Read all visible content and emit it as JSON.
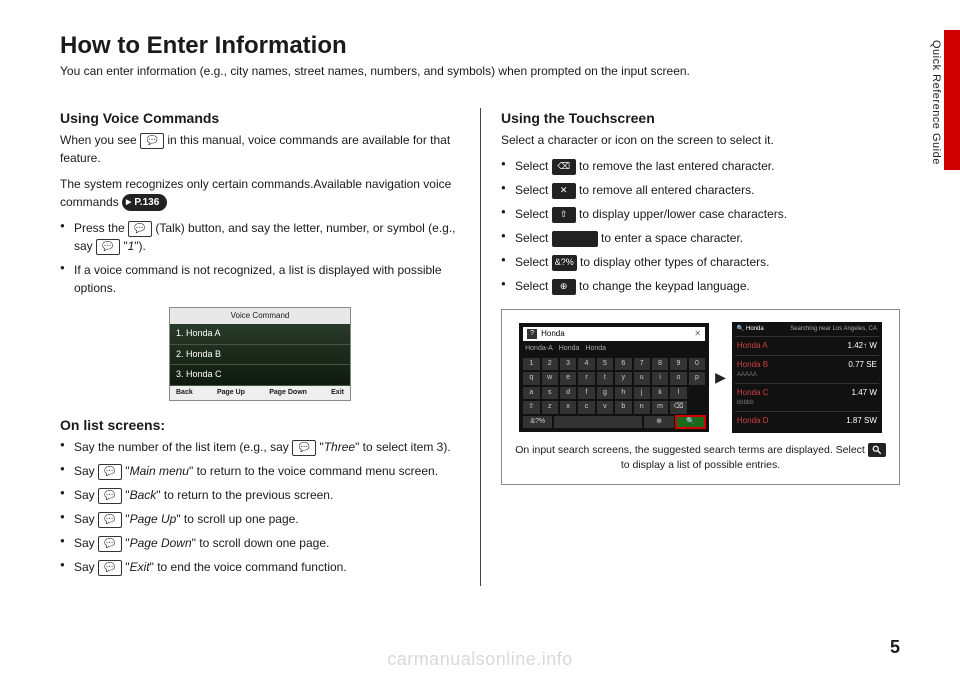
{
  "sideTab": "Quick Reference Guide",
  "title": "How to Enter Information",
  "intro": "You can enter information (e.g., city names, street names, numbers, and symbols) when prompted on the input screen.",
  "pageNum": "5",
  "watermark": "carmanualsonline.info",
  "voice": {
    "heading": "Using Voice Commands",
    "p1a": "When you see ",
    "p1b": " in this manual, voice commands are available for that feature.",
    "p2": "The system recognizes only certain commands.Available navigation voice commands ",
    "pageRef": "P.136",
    "b1a": "Press the ",
    "b1b": " (Talk) button, and say the letter, number, or symbol (e.g., say ",
    "b1c": " \"",
    "b1cmd": "1",
    "b1d": "\").",
    "b2": "If a voice command is not recognized, a list is displayed with possible options.",
    "shot": {
      "title": "Voice Command",
      "items": [
        "1. Honda A",
        "2. Honda B",
        "3. Honda C"
      ],
      "foot": [
        "Back",
        "Page Up",
        "Page Down",
        "Exit"
      ]
    }
  },
  "list": {
    "heading": "On list screens:",
    "b1a": "Say the number of the list item (e.g., say ",
    "b1b": " \"",
    "b1cmd": "Three",
    "b1c": "\" to select item 3).",
    "b2a": "Say ",
    "b2cmd": "Main menu",
    "b2b": "\" to return to the voice command menu screen.",
    "b3a": "Say ",
    "b3cmd": "Back",
    "b3b": "\" to return to the previous screen.",
    "b4a": "Say ",
    "b4cmd": "Page Up",
    "b4b": "\" to scroll up one page.",
    "b5a": "Say ",
    "b5cmd": "Page Down",
    "b5b": "\" to scroll down one page.",
    "b6a": "Say ",
    "b6cmd": "Exit",
    "b6b": "\" to end the voice command function."
  },
  "touch": {
    "heading": "Using the Touchscreen",
    "intro": "Select a character or icon on the screen to select it.",
    "b1": " to remove the last entered character.",
    "b2": " to remove all entered characters.",
    "b3": " to display upper/lower case characters.",
    "b4": " to enter a space character.",
    "b5": " to display other types of characters.",
    "b6": " to change the keypad language.",
    "select": "Select ",
    "icons": {
      "del": "⌫",
      "clear": "✕",
      "shift": "⇧",
      "sym": "&?%",
      "globe": "⊕"
    },
    "kb": {
      "input": "Honda",
      "sugg": [
        "Honda-A",
        "Honda",
        "Honda"
      ],
      "rows": [
        [
          "1",
          "2",
          "3",
          "4",
          "5",
          "6",
          "7",
          "8",
          "9",
          "0"
        ],
        [
          "q",
          "w",
          "e",
          "r",
          "t",
          "y",
          "u",
          "i",
          "o",
          "p"
        ],
        [
          "a",
          "s",
          "d",
          "f",
          "g",
          "h",
          "j",
          "k",
          "l",
          ""
        ],
        [
          "⇧",
          "z",
          "x",
          "c",
          "v",
          "b",
          "n",
          "m",
          "⌫",
          ""
        ]
      ]
    },
    "results": {
      "headLeft": "Honda",
      "headRight": "Searching near Los Angeles, CA",
      "rows": [
        {
          "name": "Honda A",
          "sub": "",
          "dist": "1.42↑ W"
        },
        {
          "name": "Honda B",
          "sub": "AAAAA",
          "dist": "0.77 SE"
        },
        {
          "name": "Honda C",
          "sub": "bbbbb",
          "dist": "1.47 W"
        },
        {
          "name": "Honda D",
          "sub": "",
          "dist": "1.87 SW"
        }
      ]
    },
    "caption1": "On input search screens, the suggested search terms are displayed. Select ",
    "caption2": " to display a list of possible entries."
  }
}
